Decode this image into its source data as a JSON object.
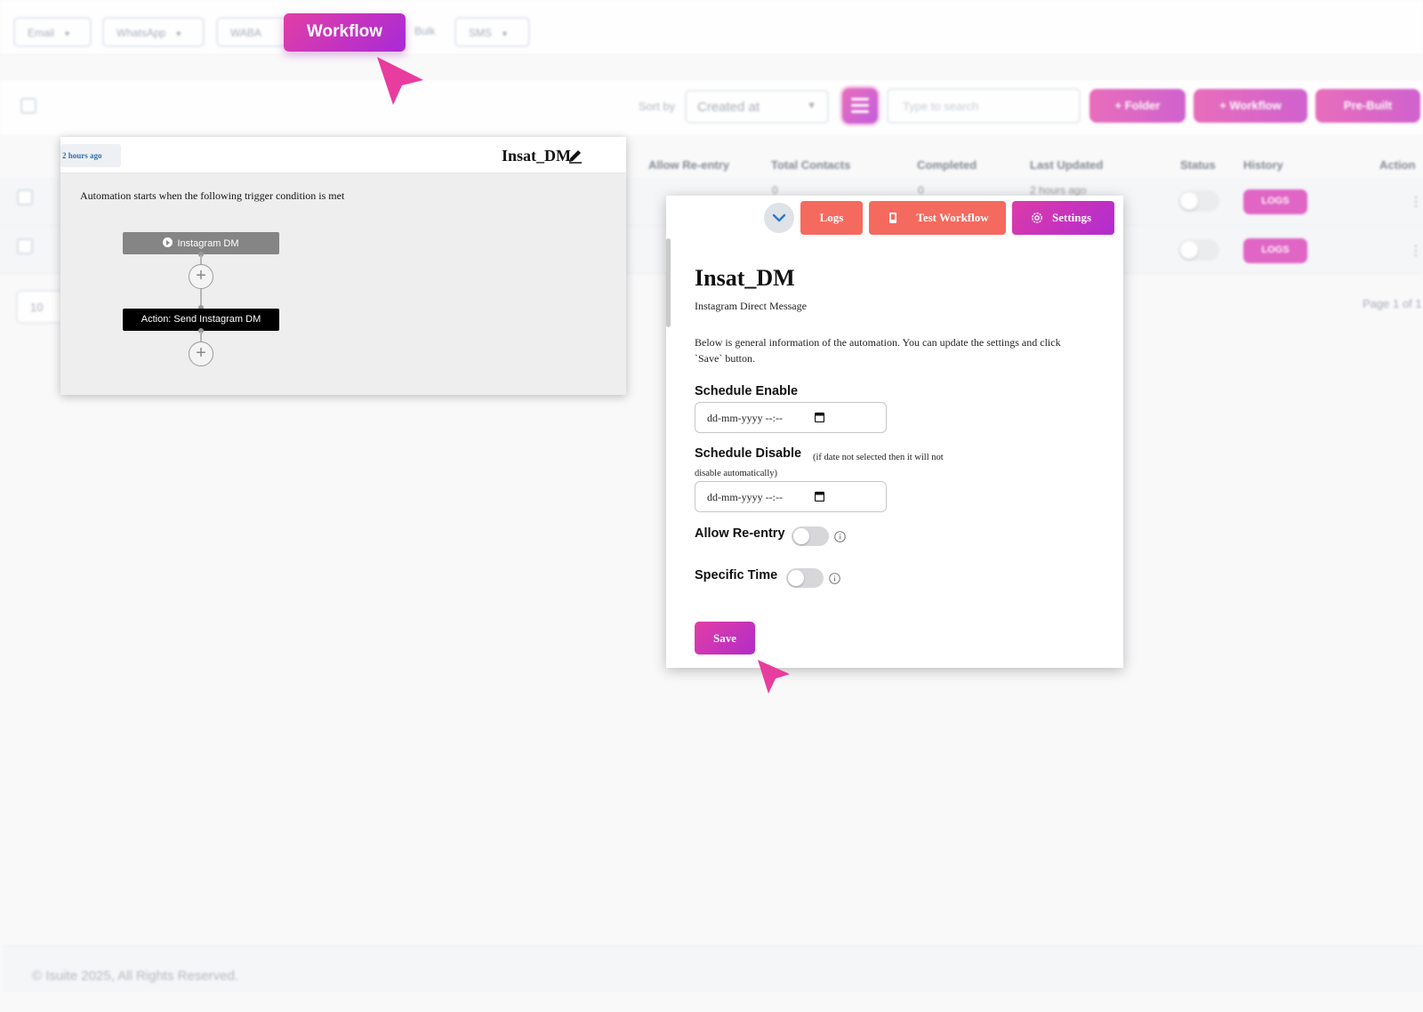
{
  "channels": [
    {
      "label": "Email"
    },
    {
      "label": "WhatsApp"
    },
    {
      "label": "WABA"
    },
    {
      "label": "Bulk"
    },
    {
      "label": "SMS"
    }
  ],
  "workflow_tab": {
    "label": "Workflow"
  },
  "toolbar": {
    "sort_label": "Sort by",
    "sort_value": "Created at",
    "search_placeholder": "Type to search",
    "folder_btn": "+ Folder",
    "workflow_btn": "+ Workflow",
    "prebuilt_btn": "Pre-Built"
  },
  "table": {
    "headers": [
      "Allow Re-entry",
      "Total Contacts",
      "Completed",
      "Last Updated",
      "Status",
      "History",
      "Action"
    ],
    "rows": [
      {
        "total": "0",
        "completed": "0",
        "updated": "2 hours ago",
        "logs": "LOGS"
      },
      {
        "logs": "LOGS"
      }
    ],
    "per_page": "10",
    "page_info": "Page 1 of 1"
  },
  "canvas": {
    "time_badge": "2 hours ago",
    "title": "Insat_DM",
    "trigger_caption": "Automation starts when the following trigger condition is met",
    "trigger_node": "Instagram DM",
    "action_node": "Action: Send Instagram DM",
    "plus_symbol": "+"
  },
  "panel": {
    "logs_btn": "Logs",
    "test_btn": "Test Workflow",
    "settings_btn": "Settings",
    "title": "Insat_DM",
    "subtitle": "Instagram Direct Message",
    "description": "Below is general information of the automation. You can update the settings and click `Save` button.",
    "schedule_enable_label": "Schedule Enable",
    "schedule_enable_value": "dd-mm-yyyy --:--",
    "schedule_disable_label": "Schedule Disable",
    "schedule_disable_note": "(if date not selected then it will not disable automatically)",
    "schedule_disable_value": "dd-mm-yyyy --:--",
    "allow_reentry_label": "Allow Re-entry",
    "specific_time_label": "Specific Time",
    "save_btn": "Save"
  },
  "footer": {
    "text": "© Isuite 2025, All Rights Reserved."
  },
  "colors": {
    "accent_pink": "#e23ea6",
    "accent_purple": "#b02ad4",
    "coral": "#f56a5e"
  }
}
